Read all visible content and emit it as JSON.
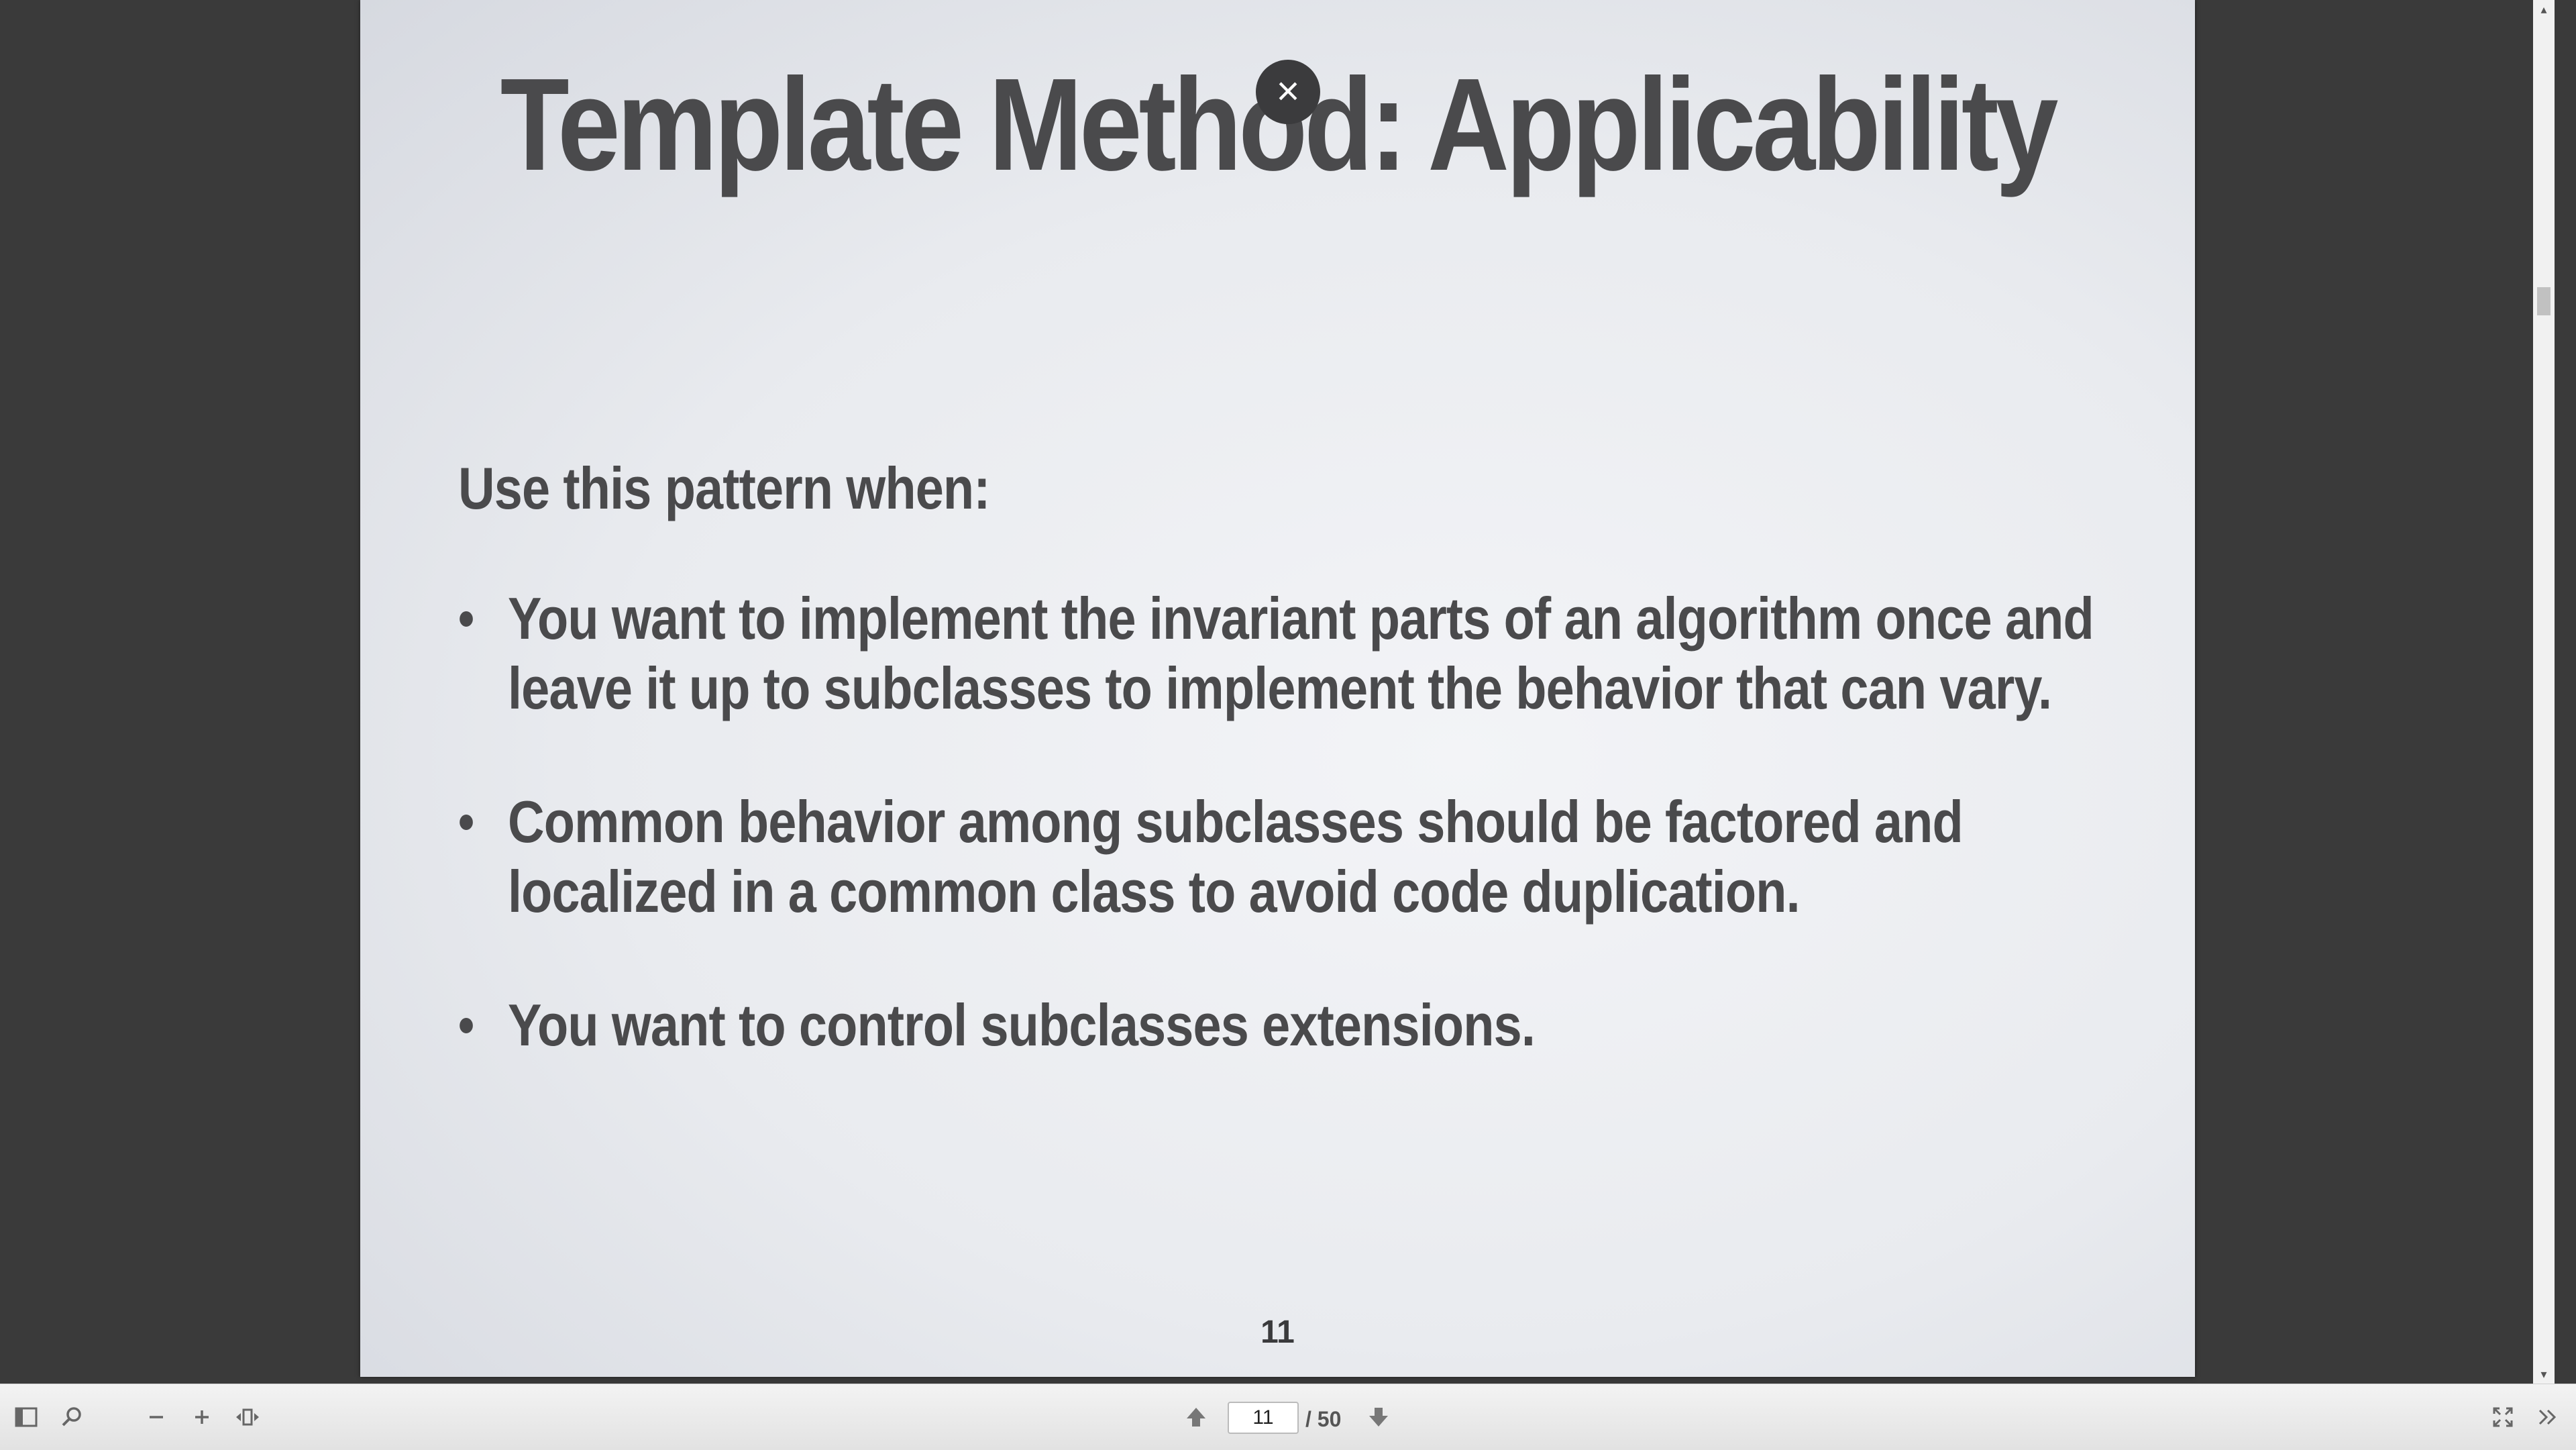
{
  "slide": {
    "title": "Template Method: Applicability",
    "intro": "Use this pattern when:",
    "bullets": [
      "You want to implement the invariant parts of an algorithm once and leave it up to subclasses to implement the behavior that can vary.",
      "Common behavior among subclasses should be factored and localized in a common class to avoid code duplication.",
      "You want to control subclasses extensions."
    ],
    "number": "11"
  },
  "close_button": {
    "symbol": "×"
  },
  "toolbar": {
    "current_page": "11",
    "total_pages": "/ 50",
    "icons": [
      "sidebar-toggle-icon",
      "search-icon",
      "zoom-out-icon",
      "zoom-in-icon",
      "fit-page-icon",
      "previous-page-icon",
      "next-page-icon",
      "fullscreen-icon",
      "more-tools-icon"
    ]
  }
}
